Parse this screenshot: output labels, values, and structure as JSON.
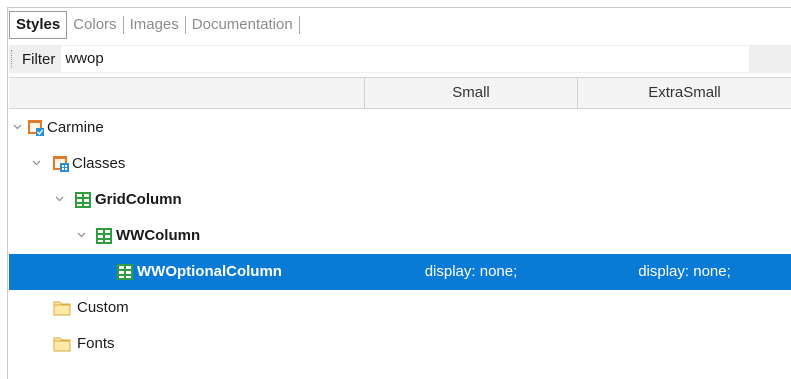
{
  "tabs": [
    {
      "label": "Styles",
      "active": true
    },
    {
      "label": "Colors",
      "active": false
    },
    {
      "label": "Images",
      "active": false
    },
    {
      "label": "Documentation",
      "active": false
    }
  ],
  "filter": {
    "label": "Filter",
    "value": "wwop"
  },
  "columns": [
    "Small",
    "ExtraSmall"
  ],
  "tree": [
    {
      "label": "Carmine",
      "icon": "theme-icon",
      "bold": false,
      "expanded": true,
      "level": 0
    },
    {
      "label": "Classes",
      "icon": "classes-icon",
      "bold": false,
      "expanded": true,
      "level": 1
    },
    {
      "label": "GridColumn",
      "icon": "grid-class-icon",
      "bold": true,
      "expanded": true,
      "level": 2
    },
    {
      "label": "WWColumn",
      "icon": "grid-class-icon",
      "bold": true,
      "expanded": true,
      "level": 3
    },
    {
      "label": "WWOptionalColumn",
      "icon": "grid-class-icon",
      "bold": true,
      "selected": true,
      "level": 4,
      "values": [
        "display: none;",
        "display: none;"
      ]
    },
    {
      "label": "Custom",
      "icon": "folder-icon",
      "bold": false,
      "level": 1
    },
    {
      "label": "Fonts",
      "icon": "folder-icon",
      "bold": false,
      "level": 1
    }
  ],
  "colors": {
    "selection": "#0a7ad7",
    "folder": "#f4cf6b",
    "grid_icon": "#2e9e3f",
    "theme_icon": "#e07b2a"
  }
}
